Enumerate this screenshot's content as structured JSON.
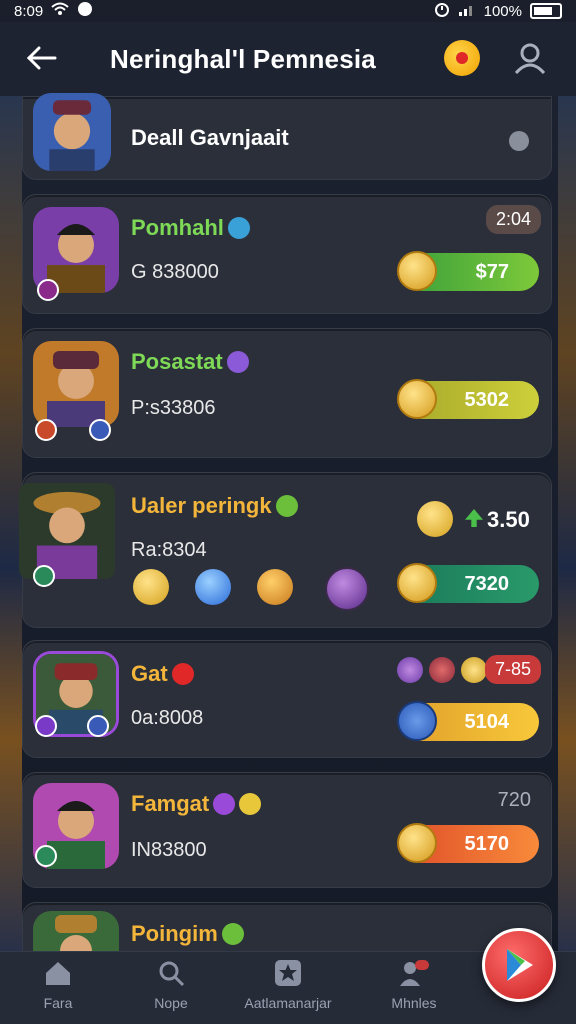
{
  "status_bar": {
    "time": "8:09",
    "battery": "100%"
  },
  "header": {
    "title": "Neringhal'l Pemnesia"
  },
  "cards": [
    {
      "name": "Deall Gavnjaait",
      "name_color": "#ffffff",
      "subtitle": "",
      "tag": "",
      "price": ""
    },
    {
      "name": "Pomhahl",
      "name_color": "#7ed957",
      "subtitle": "G 838000",
      "tag": "2:04",
      "price": "$77",
      "pill_color": "#6cbf3a"
    },
    {
      "name": "Posastat",
      "name_color": "#7ed957",
      "subtitle": "P:s33806",
      "tag": "",
      "price": "5302",
      "pill_color": "#b8c03a"
    },
    {
      "name": "Ualer peringk",
      "name_color": "#f4b63a",
      "subtitle": "Ra:8304",
      "tag": "",
      "price": "7320",
      "price_top": "3.50",
      "pill_color": "#1f8a5a"
    },
    {
      "name": "Gat",
      "name_color": "#f4b63a",
      "subtitle": "0a:8008",
      "tag": "7-85",
      "price": "5104",
      "pill_color": "#f0b132"
    },
    {
      "name": "Famgat",
      "name_color": "#f4b63a",
      "subtitle": "IN83800",
      "tag": "720",
      "price": "5170",
      "pill_color": "#f06a2a"
    },
    {
      "name": "Poingim",
      "name_color": "#f4b63a",
      "subtitle": "",
      "tag": "",
      "price": ""
    }
  ],
  "nav": [
    {
      "label": "Fara"
    },
    {
      "label": "Nope"
    },
    {
      "label": "Aatlamanarjar"
    },
    {
      "label": "Mhnles"
    }
  ],
  "colors": {
    "accent_green": "#7ed957",
    "accent_gold": "#f4b63a",
    "card_bg": "#2b2f3a"
  }
}
